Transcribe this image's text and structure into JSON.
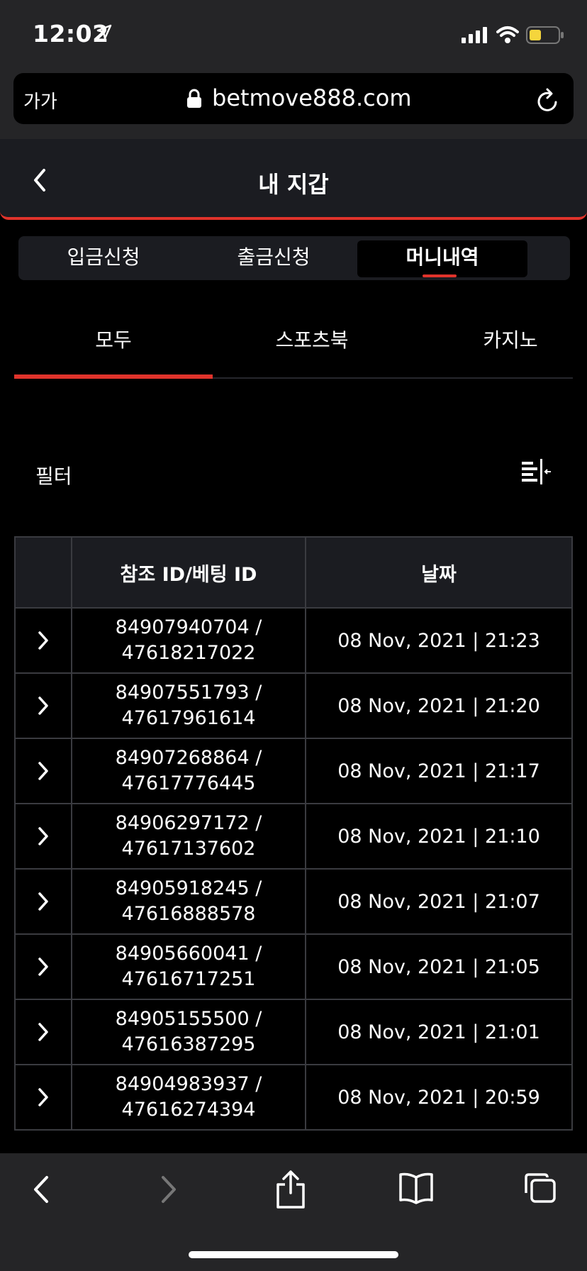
{
  "status_bar": {
    "time": "12:02"
  },
  "browser": {
    "text_size_button": "가가",
    "url": "betmove888.com"
  },
  "header": {
    "title": "내 지갑"
  },
  "segment_tabs": [
    "입금신청",
    "출금신청",
    "머니내역"
  ],
  "sub_tabs": [
    "모두",
    "스포츠북",
    "카지노"
  ],
  "filter": {
    "label": "필터"
  },
  "table": {
    "headers": [
      "참조 ID/베팅 ID",
      "날짜"
    ],
    "rows": [
      {
        "ref": "84907940704 /",
        "bet": "47618217022",
        "date": "08 Nov, 2021 | 21:23"
      },
      {
        "ref": "84907551793 /",
        "bet": "47617961614",
        "date": "08 Nov, 2021 | 21:20"
      },
      {
        "ref": "84907268864 /",
        "bet": "47617776445",
        "date": "08 Nov, 2021 | 21:17"
      },
      {
        "ref": "84906297172 /",
        "bet": "47617137602",
        "date": "08 Nov, 2021 | 21:10"
      },
      {
        "ref": "84905918245 /",
        "bet": "47616888578",
        "date": "08 Nov, 2021 | 21:07"
      },
      {
        "ref": "84905660041 /",
        "bet": "47616717251",
        "date": "08 Nov, 2021 | 21:05"
      },
      {
        "ref": "84905155500 /",
        "bet": "47616387295",
        "date": "08 Nov, 2021 | 21:01"
      },
      {
        "ref": "84904983937 /",
        "bet": "47616274394",
        "date": "08 Nov, 2021 | 20:59"
      }
    ]
  },
  "colors": {
    "accent": "#e0332b",
    "panel": "#1b1c21",
    "chrome": "#252527",
    "battery": "#f5d53c"
  }
}
